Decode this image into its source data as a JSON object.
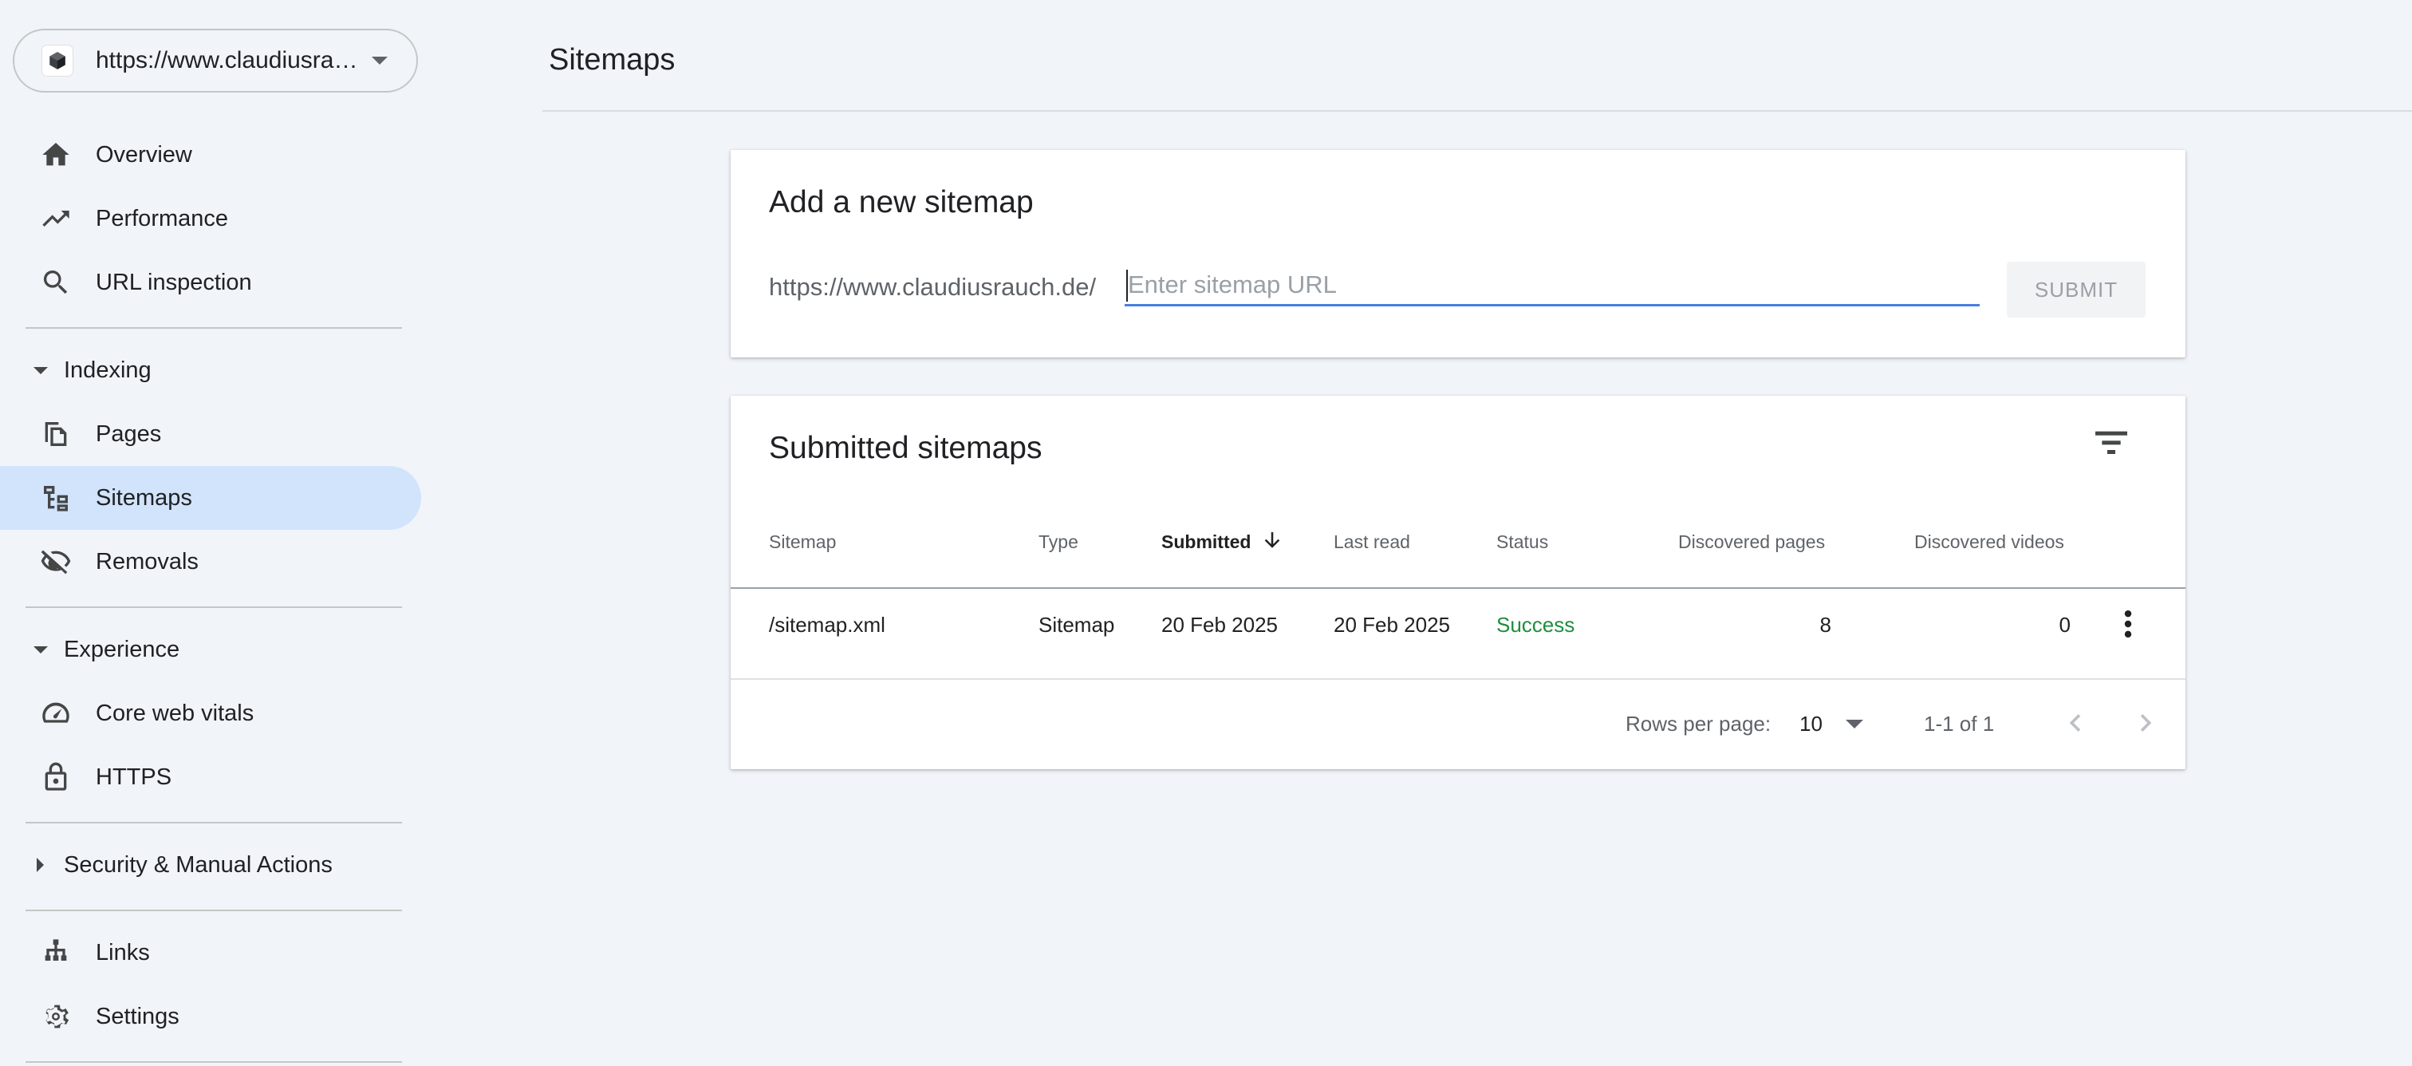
{
  "property": {
    "url": "https://www.claudiusrauch.de/"
  },
  "nav": {
    "overview": "Overview",
    "performance": "Performance",
    "url_inspection": "URL inspection",
    "indexing": "Indexing",
    "pages": "Pages",
    "sitemaps": "Sitemaps",
    "removals": "Removals",
    "experience": "Experience",
    "core_web_vitals": "Core web vitals",
    "https": "HTTPS",
    "security": "Security & Manual Actions",
    "links": "Links",
    "settings": "Settings"
  },
  "page": {
    "title": "Sitemaps"
  },
  "add_sitemap": {
    "title": "Add a new sitemap",
    "prefix": "https://www.claudiusrauch.de/",
    "placeholder": "Enter sitemap URL",
    "value": "",
    "submit_label": "SUBMIT"
  },
  "submitted": {
    "title": "Submitted sitemaps",
    "columns": {
      "sitemap": "Sitemap",
      "type": "Type",
      "submitted": "Submitted",
      "last_read": "Last read",
      "status": "Status",
      "discovered_pages": "Discovered pages",
      "discovered_videos": "Discovered videos"
    },
    "rows": [
      {
        "sitemap": "/sitemap.xml",
        "type": "Sitemap",
        "submitted": "20 Feb 2025",
        "last_read": "20 Feb 2025",
        "status": "Success",
        "discovered_pages": "8",
        "discovered_videos": "0"
      }
    ],
    "pagination": {
      "rows_per_page_label": "Rows per page:",
      "rows_per_page": "10",
      "range": "1-1 of 1"
    }
  },
  "colors": {
    "active_nav": "#d2e3fc",
    "accent": "#4a7ee0",
    "success": "#1e8e3e"
  },
  "icons": {
    "property": "cube-icon",
    "overview": "home-icon",
    "performance": "trending-up-icon",
    "url_inspection": "search-icon",
    "pages": "pages-icon",
    "sitemaps": "sitemap-icon",
    "removals": "visibility-off-icon",
    "core_web_vitals": "speedometer-icon",
    "https": "lock-icon",
    "links": "links-icon",
    "settings": "gear-icon",
    "filter": "filter-icon",
    "sort": "arrow-down-icon",
    "more": "more-vert-icon"
  }
}
